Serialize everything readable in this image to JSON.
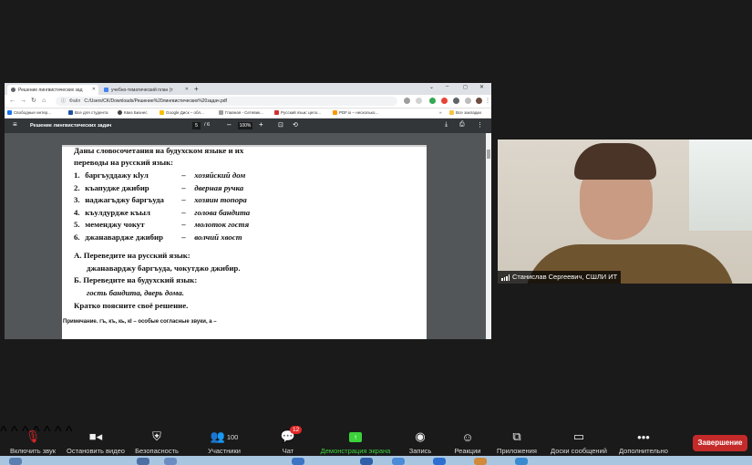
{
  "browser": {
    "tabs": [
      {
        "title": "Решение лингвистических зад"
      },
      {
        "title": "учебно-тематический план (т"
      }
    ],
    "new_tab_label": "+",
    "window_controls": [
      "⌄",
      "–",
      "◻",
      "✕"
    ],
    "url_scheme_label": "Файл",
    "url": "C:/Users/CK/Downloads/Решение%20лингвистических%20задач.pdf",
    "bookmarks": [
      {
        "label": "Свободные интер...",
        "color": "#1a73e8"
      },
      {
        "label": "Все для студента",
        "color": "#1e50a0"
      },
      {
        "label": "Квиз Бизнес",
        "color": "#444444"
      },
      {
        "label": "Google Диск – обл...",
        "color": "#fbbc04"
      },
      {
        "label": "Главная - Сетевик...",
        "color": "#9e9e9e"
      },
      {
        "label": "Русский язык: цело...",
        "color": "#d32f2f"
      },
      {
        "label": "PDF.io – несколько...",
        "color": "#ff9800"
      }
    ],
    "all_bookmarks": "Все закладки"
  },
  "pdf": {
    "title": "Решение лингвистических задач",
    "page_current": "5",
    "page_total": "/ 6",
    "zoom": "100%",
    "intro": "Даны словосочетания на будухском языке и их переводы на русский язык:",
    "phrases": [
      {
        "num": "1.",
        "source": "баргъуддажу кlул",
        "dash": "–",
        "translation": "хозяйский дом"
      },
      {
        "num": "2.",
        "source": "къапудже джибир",
        "dash": "–",
        "translation": "дверная ручка"
      },
      {
        "num": "3.",
        "source": "наджагъджу баргъуда",
        "dash": "–",
        "translation": "хозяин топора"
      },
      {
        "num": "4.",
        "source": "къулдурдже къыл",
        "dash": "–",
        "translation": "голова бандита"
      },
      {
        "num": "5.",
        "source": "меменджу чокут",
        "dash": "–",
        "translation": "молоток гостя"
      },
      {
        "num": "6.",
        "source": "джанаварджe джибир",
        "dash": "–",
        "translation": "волчий хвост"
      }
    ],
    "task_a": "А. Переведите на русский язык:",
    "task_a_items": "джанаварджу баргъуда, чокутджо джибир.",
    "task_b": "Б. Переведите на будухский язык:",
    "task_b_items": "гость бандита, дверь дома.",
    "explain": "Кратко поясните своё решение.",
    "note": "Примечание. гъ, къ, кь, кl – особые согласные звуки, а –"
  },
  "participant": {
    "name": "Станислав Сергеевич, СШЛИ ИТ"
  },
  "toolbar": {
    "mute": "Включить звук",
    "video": "Остановить видео",
    "security": "Безопасность",
    "participants": "Участники",
    "participants_count": "100",
    "chat": "Чат",
    "chat_badge": "12",
    "share": "Демонстрация экрана",
    "record": "Запись",
    "reactions": "Реакции",
    "apps": "Приложения",
    "whiteboards": "Доски сообщений",
    "more": "Дополнительно",
    "end": "Завершение"
  },
  "colors": {
    "share_active": "#3bd23b",
    "end_button": "#c52a2a",
    "badge": "#e02828"
  }
}
